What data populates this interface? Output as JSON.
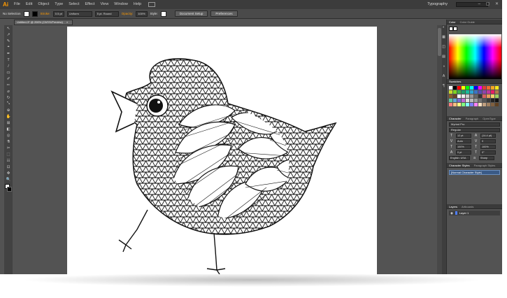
{
  "app": {
    "logo": "Ai",
    "menu": [
      "File",
      "Edit",
      "Object",
      "Type",
      "Select",
      "Effect",
      "View",
      "Window",
      "Help"
    ],
    "workspace": "Typography",
    "window_buttons": "‒ ▢ ✕"
  },
  "controlbar": {
    "selection": "No Selection",
    "stroke_label": "Stroke:",
    "stroke_weight": "0.5 pt",
    "profile": "Uniform",
    "brush": "5 pt. Round",
    "opacity_label": "Opacity:",
    "opacity_value": "100%",
    "style_label": "Style:",
    "document_setup": "Document Setup",
    "preferences": "Preferences"
  },
  "document": {
    "tab_title": "Untitled-3* @ 206% (CMYK/Preview)",
    "close": "×"
  },
  "tools": [
    "↖",
    "↗",
    "✎",
    "⌖",
    "✒",
    "T",
    "/",
    "▭",
    "✐",
    "✏",
    "⌀",
    "↻",
    "⤡",
    "⊕",
    "✋",
    "⊞",
    "◧",
    "◎",
    "⚗",
    "✂",
    "⬚",
    "☷",
    "⊡",
    "✥",
    "🔍"
  ],
  "dock_icons": [
    "◐",
    "▦",
    "◫",
    "▤",
    "◑",
    "A",
    "¶"
  ],
  "panels": {
    "color_tabs": [
      "Color",
      "Color Guide"
    ],
    "swatches_tab": "Swatches",
    "character_tabs": [
      "Character",
      "Paragraph",
      "OpenType"
    ],
    "font_family": "Myriad Pro",
    "font_style": "Regular",
    "font_size": "12 pt",
    "leading": "(14.4 pt)",
    "kerning": "Auto",
    "tracking": "0",
    "scale_v": "100%",
    "scale_h": "100%",
    "baseline": "0 pt",
    "rotation": "0°",
    "language": "English: USA",
    "aa": "Sharp",
    "character_styles_tabs": [
      "Character Styles",
      "Paragraph Styles"
    ],
    "character_style_item": "[Normal Character Style]",
    "layers_tabs": [
      "Layers",
      "Artboards"
    ],
    "layer_name": "Layer 1"
  },
  "colors": {
    "accent": "#ff9a00",
    "ui_bg": "#535353",
    "menubar": "#3c3c3c"
  },
  "swatches": [
    "#ffffff",
    "#000000",
    "#ff0000",
    "#ffff00",
    "#00ff00",
    "#00ffff",
    "#0000ff",
    "#ff00ff",
    "#e23a3a",
    "#ee6b2f",
    "#f5a623",
    "#f8e71c",
    "#c9d92f",
    "#7ed321",
    "#3fae49",
    "#1f9d6b",
    "#1abc9c",
    "#2aa5d6",
    "#3b73c7",
    "#5b4bb3",
    "#8e44ad",
    "#c0399b",
    "#e91e63",
    "#b07a4a",
    "#8b5a2b",
    "#6b4226",
    "#ffffff",
    "#eeeeee",
    "#cccccc",
    "#999999",
    "#666666",
    "#333333",
    "#d65f5f",
    "#e89a5a",
    "#f2d16b",
    "#9bd35f",
    "#5fc9a1",
    "#5fa8d6",
    "#7a6ad6",
    "#c36ad6",
    "#e0e0e0",
    "#bdbdbd",
    "#9e9e9e",
    "#757575",
    "#555555",
    "#3a3a3a",
    "#222222",
    "#111111",
    "#ff8080",
    "#ffbf80",
    "#ffff80",
    "#80ff80",
    "#80ffff",
    "#8080ff",
    "#ff80ff",
    "#ffe0c0",
    "#c0a080",
    "#a08060",
    "#806040",
    "#604020"
  ]
}
